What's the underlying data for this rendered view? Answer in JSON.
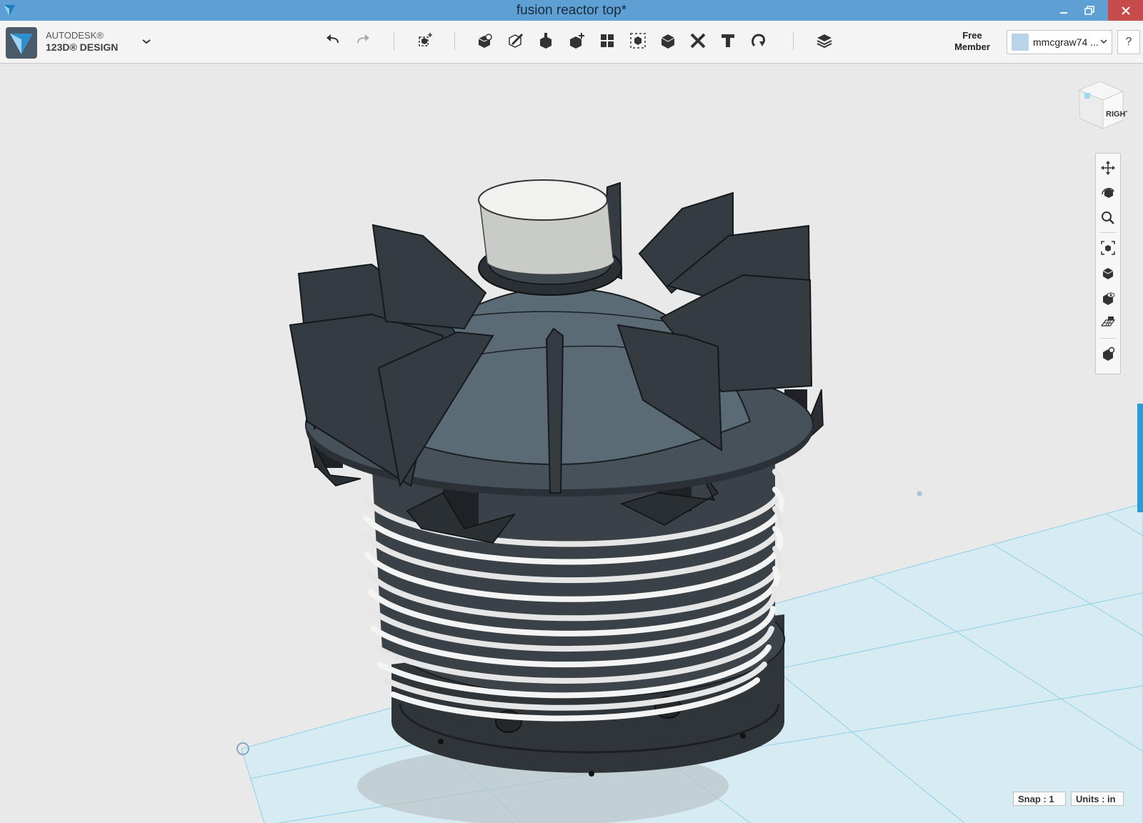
{
  "window": {
    "title": "fusion reactor top*"
  },
  "brand": {
    "line1": "AUTODESK®",
    "line2": "123D® DESIGN"
  },
  "toolbar": {
    "icons": [
      "undo-icon",
      "redo-icon",
      "transform-icon",
      "primitives-icon",
      "sketch-icon",
      "construct-icon",
      "modify-icon",
      "pattern-icon",
      "group-icon",
      "combine-icon",
      "measure-icon",
      "text-icon",
      "snap-icon",
      "material-icon"
    ]
  },
  "account": {
    "member_line1": "Free",
    "member_line2": "Member",
    "username": "mmcgraw74 ...",
    "help": "?"
  },
  "viewcube": {
    "face_label": "RIGHT"
  },
  "nav_tools": [
    "pan-icon",
    "orbit-icon",
    "zoom-icon",
    "fit-icon",
    "view-solid-icon",
    "visibility-icon",
    "grid-icon",
    "material-view-icon"
  ],
  "status": {
    "snap": "Snap : 1",
    "units": "Units : in"
  },
  "colors": {
    "titlebar": "#5e9fd4",
    "accent": "#2d9bd7",
    "model_dark": "#3b4249",
    "model_mid": "#55606a",
    "coil": "#f3f3f3",
    "grid": "#d2ebf4"
  }
}
